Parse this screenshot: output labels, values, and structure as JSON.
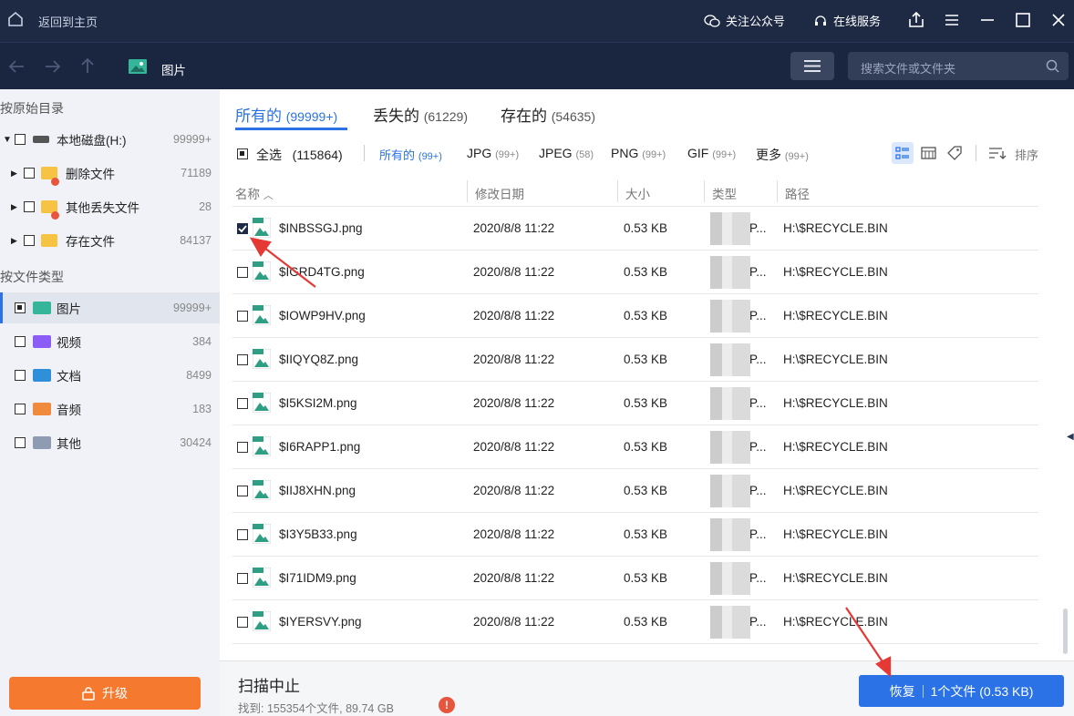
{
  "titlebar": {
    "back_home": "返回到主页",
    "follow": "关注公众号",
    "online_service": "在线服务"
  },
  "navbar": {
    "location": "图片",
    "search_placeholder": "搜索文件或文件夹"
  },
  "sidebar": {
    "section1": "按原始目录",
    "drive": {
      "label": "本地磁盘(H:)",
      "count": "99999+"
    },
    "folders": [
      {
        "label": "删除文件",
        "count": "71189"
      },
      {
        "label": "其他丢失文件",
        "count": "28"
      },
      {
        "label": "存在文件",
        "count": "84137"
      }
    ],
    "section2": "按文件类型",
    "types": [
      {
        "label": "图片",
        "count": "99999+"
      },
      {
        "label": "视频",
        "count": "384"
      },
      {
        "label": "文档",
        "count": "8499"
      },
      {
        "label": "音频",
        "count": "183"
      },
      {
        "label": "其他",
        "count": "30424"
      }
    ],
    "upgrade": "升级"
  },
  "tabs": [
    {
      "label": "所有的",
      "count": "(99999+)"
    },
    {
      "label": "丢失的",
      "count": "(61229)"
    },
    {
      "label": "存在的",
      "count": "(54635)"
    }
  ],
  "filterbar": {
    "select_all": "全选",
    "select_count": "(115864)",
    "filters": [
      {
        "label": "所有的",
        "count": "(99+)"
      },
      {
        "label": "JPG",
        "count": "(99+)"
      },
      {
        "label": "JPEG",
        "count": "(58)"
      },
      {
        "label": "PNG",
        "count": "(99+)"
      },
      {
        "label": "GIF",
        "count": "(99+)"
      },
      {
        "label": "更多",
        "count": "(99+)"
      }
    ],
    "sort": "排序"
  },
  "columns": {
    "name": "名称",
    "date": "修改日期",
    "size": "大小",
    "type": "类型",
    "path": "路径"
  },
  "rows": [
    {
      "name": "$INBSSGJ.png",
      "date": "2020/8/8 11:22",
      "size": "0.53 KB",
      "type": "P...",
      "path": "H:\\$RECYCLE.BIN",
      "checked": true
    },
    {
      "name": "$IGRD4TG.png",
      "date": "2020/8/8 11:22",
      "size": "0.53 KB",
      "type": "P...",
      "path": "H:\\$RECYCLE.BIN",
      "checked": false
    },
    {
      "name": "$IOWP9HV.png",
      "date": "2020/8/8 11:22",
      "size": "0.53 KB",
      "type": "P...",
      "path": "H:\\$RECYCLE.BIN",
      "checked": false
    },
    {
      "name": "$IIQYQ8Z.png",
      "date": "2020/8/8 11:22",
      "size": "0.53 KB",
      "type": "P...",
      "path": "H:\\$RECYCLE.BIN",
      "checked": false
    },
    {
      "name": "$I5KSI2M.png",
      "date": "2020/8/8 11:22",
      "size": "0.53 KB",
      "type": "P...",
      "path": "H:\\$RECYCLE.BIN",
      "checked": false
    },
    {
      "name": "$I6RAPP1.png",
      "date": "2020/8/8 11:22",
      "size": "0.53 KB",
      "type": "P...",
      "path": "H:\\$RECYCLE.BIN",
      "checked": false
    },
    {
      "name": "$IIJ8XHN.png",
      "date": "2020/8/8 11:22",
      "size": "0.53 KB",
      "type": "P...",
      "path": "H:\\$RECYCLE.BIN",
      "checked": false
    },
    {
      "name": "$I3Y5B33.png",
      "date": "2020/8/8 11:22",
      "size": "0.53 KB",
      "type": "P...",
      "path": "H:\\$RECYCLE.BIN",
      "checked": false
    },
    {
      "name": "$I71IDM9.png",
      "date": "2020/8/8 11:22",
      "size": "0.53 KB",
      "type": "P...",
      "path": "H:\\$RECYCLE.BIN",
      "checked": false
    },
    {
      "name": "$IYERSVY.png",
      "date": "2020/8/8 11:22",
      "size": "0.53 KB",
      "type": "P...",
      "path": "H:\\$RECYCLE.BIN",
      "checked": false
    }
  ],
  "footer": {
    "status": "扫描中止",
    "found": "找到: 155354个文件, 89.74 GB",
    "recover_label": "恢复",
    "recover_detail": "1个文件 (0.53 KB)"
  },
  "colors": {
    "accent": "#2a72e5",
    "titlebar": "#1e2a44",
    "upgrade": "#f57a2f",
    "annotation": "#e53935"
  }
}
